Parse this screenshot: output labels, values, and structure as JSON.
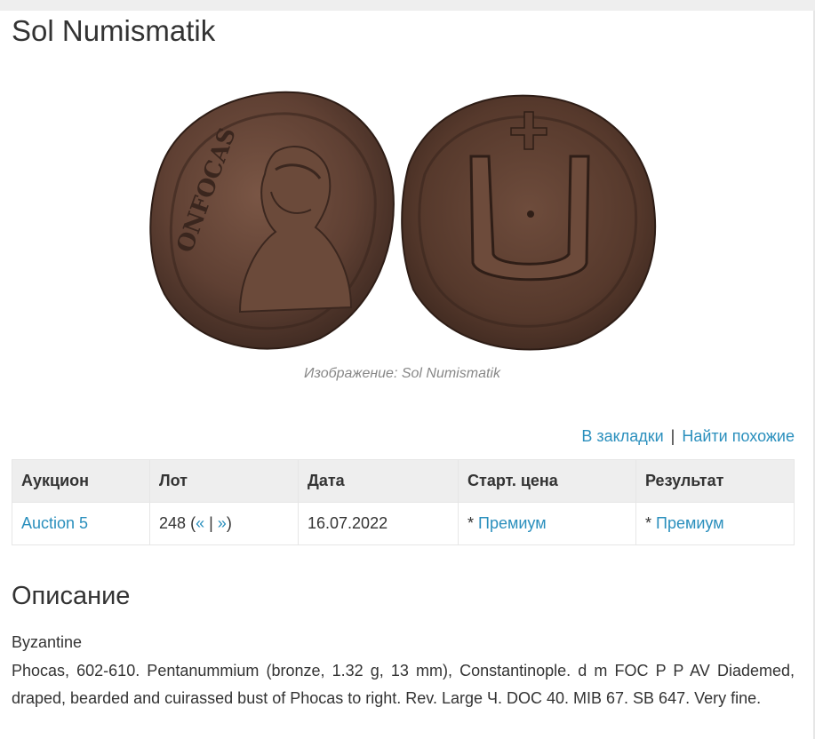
{
  "page": {
    "title": "Sol Numismatik"
  },
  "image": {
    "caption": "Изображение: Sol Numismatik",
    "obverse_legend": "ONFOCAS",
    "reverse_mark": "Ч"
  },
  "actions": {
    "bookmark": "В закладки",
    "separator": "|",
    "similar": "Найти похожие"
  },
  "table": {
    "headers": [
      "Аукцион",
      "Лот",
      "Дата",
      "Старт. цена",
      "Результат"
    ],
    "row": {
      "auction": "Auction 5",
      "lot_number": "248",
      "lot_open": "(",
      "lot_prev": "«",
      "lot_sep": "|",
      "lot_next": "»",
      "lot_close": ")",
      "date": "16.07.2022",
      "start_prefix": "*",
      "start_link": "Премиум",
      "result_prefix": "*",
      "result_link": "Премиум"
    }
  },
  "description": {
    "heading": "Описание",
    "category": "Byzantine",
    "text": "Phocas, 602-610. Pentanummium (bronze, 1.32 g, 13 mm), Constantinople. d m FOC P P AV Diademed, draped, bearded and cuirassed bust of Phocas to right. Rev. Large Ч. DOC 40. MIB 67. SB 647. Very fine."
  },
  "colors": {
    "link": "#2a8fbd",
    "header_bg": "#eeeeee",
    "coin_bronze": "#5e3f30"
  }
}
